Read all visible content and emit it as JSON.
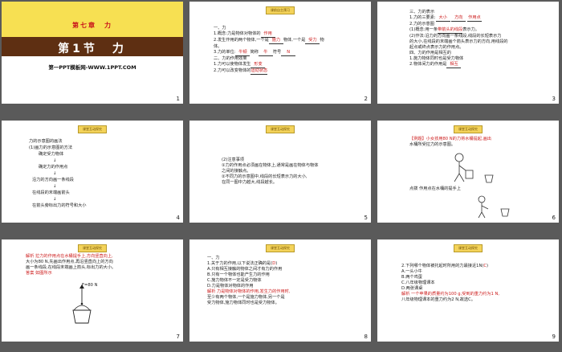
{
  "slides": [
    {
      "num": "1",
      "chapter": "第七章　力",
      "title": "第1节　力",
      "site": "第一PPT模板网-WWW.1PPT.COM"
    },
    {
      "num": "2",
      "badge": "课前自主预习",
      "lines": [
        "一、力",
        "1.概念:力是物体对物体的",
        "作用",
        "2.发生作用的两个物体,一个是",
        "施力",
        "物体,一个是",
        "受力",
        "物",
        "体。",
        "3.力的单位:",
        "牛顿",
        "简称",
        "牛",
        "符号",
        "N",
        "二、力的作用效果",
        "1.力可以使物体发生",
        "形变",
        "2.力可以改变物体的",
        "运动状态"
      ]
    },
    {
      "num": "3",
      "lines": [
        "三、力的表示",
        "1.力的三要素:",
        "大小",
        "方向",
        "作用点",
        "2.力的示意图",
        "(1)概念:用一条",
        "带箭头的线段",
        "表示力。",
        "(2)作法:沿力的方向画一条线段,线段的长短表示力",
        "的大小,在线段的末端画个箭头表示力的方向,用线段的",
        "起点或终点表示力的作用点。",
        "四、力的作用是相互的",
        "1.施力物体同时也是受力物体",
        "2.物体间力的作用是",
        "相互"
      ]
    },
    {
      "num": "4",
      "badge": "课堂互动探究",
      "flow": [
        "力的示意图的画法",
        "(1)画力的示意图的方法",
        "确定受力物体",
        "确定力的作用点",
        "沿力的方向画一条线段",
        "在线段的末端画箭头",
        "在箭头旁标出力的符号和大小"
      ]
    },
    {
      "num": "5",
      "badge": "课堂互动探究",
      "lines": [
        "(2)注意事项",
        "①力的作用点必须画在物体上,通常是画在物体与物体",
        "之间的接触点。",
        "②不同力的示意图中,线段的长短表示力的大小,",
        "在同一图中力越大,线段越长。"
      ]
    },
    {
      "num": "6",
      "badge": "课堂互动探究",
      "lines": [
        "【例题】小女孩用80 N的力将水桶提起,画出",
        "水桶所受拉力的示意图。",
        "点拨 作用点在水桶的提手上"
      ]
    },
    {
      "num": "7",
      "badge": "课堂互动探究",
      "lines": [
        "解析 拉力的作用点在水桶提手上,方向竖直向上,",
        "大小为80 N,先画出作用点,再沿竖直向上的方向",
        "画一条线段,在线段末端画上箭头,标出力的大小。",
        "答案 如图所示"
      ],
      "force_label": "F=80 N"
    },
    {
      "num": "8",
      "badge": "课堂互动探究",
      "lines": [
        "一、力",
        "1.关于力的作用,以下说法正确的是(",
        "D",
        ")",
        "A.只有相互接触的物体之间才有力的作用",
        "B.只有一个物体也能产生力的作用",
        "C.施力物体不一定是受力物体",
        "D.力是物体对物体的作用",
        "解析 力是物体对物体的作用,发生力的作用时,",
        "至少有两个物体,一个是施力物体,另一个是",
        "受力物体,施力物体同时也是受力物体。"
      ]
    },
    {
      "num": "9",
      "badge": "课堂互动探究",
      "lines": [
        "2.下列哪个物体被托起时所用的力最接近1N(",
        "C",
        ")",
        "A.一头小牛",
        "B.两个鸡蛋",
        "C.八年级物理课本",
        "D.两张课桌",
        "解析 一个苹果的质量约为100 g,受到的重力约为1 N,",
        "八年级物理课本的重力约为2 N,故选C。"
      ]
    }
  ]
}
